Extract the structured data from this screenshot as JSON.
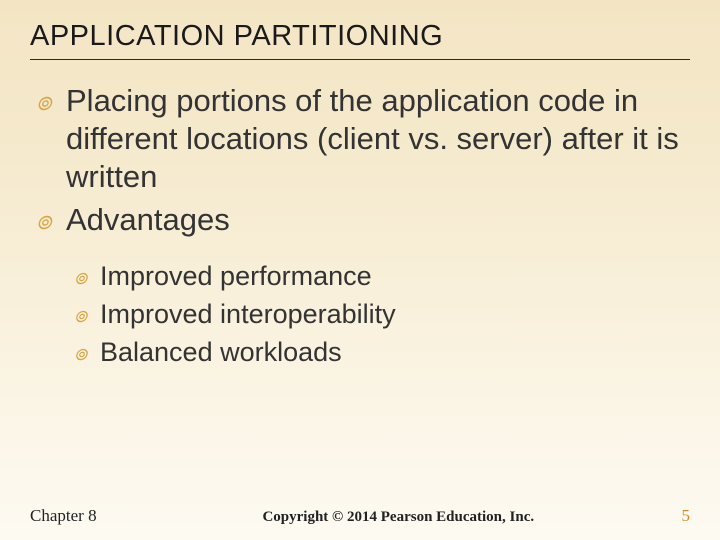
{
  "title": "APPLICATION PARTITIONING",
  "bullets": [
    "Placing portions of the application code in different locations (client vs. server) after it is written",
    "Advantages"
  ],
  "sub_bullets": [
    "Improved performance",
    "Improved interoperability",
    "Balanced workloads"
  ],
  "footer": {
    "chapter": "Chapter 8",
    "copyright": "Copyright © 2014 Pearson Education, Inc.",
    "page": "5"
  },
  "colors": {
    "accent": "#d9a441"
  }
}
